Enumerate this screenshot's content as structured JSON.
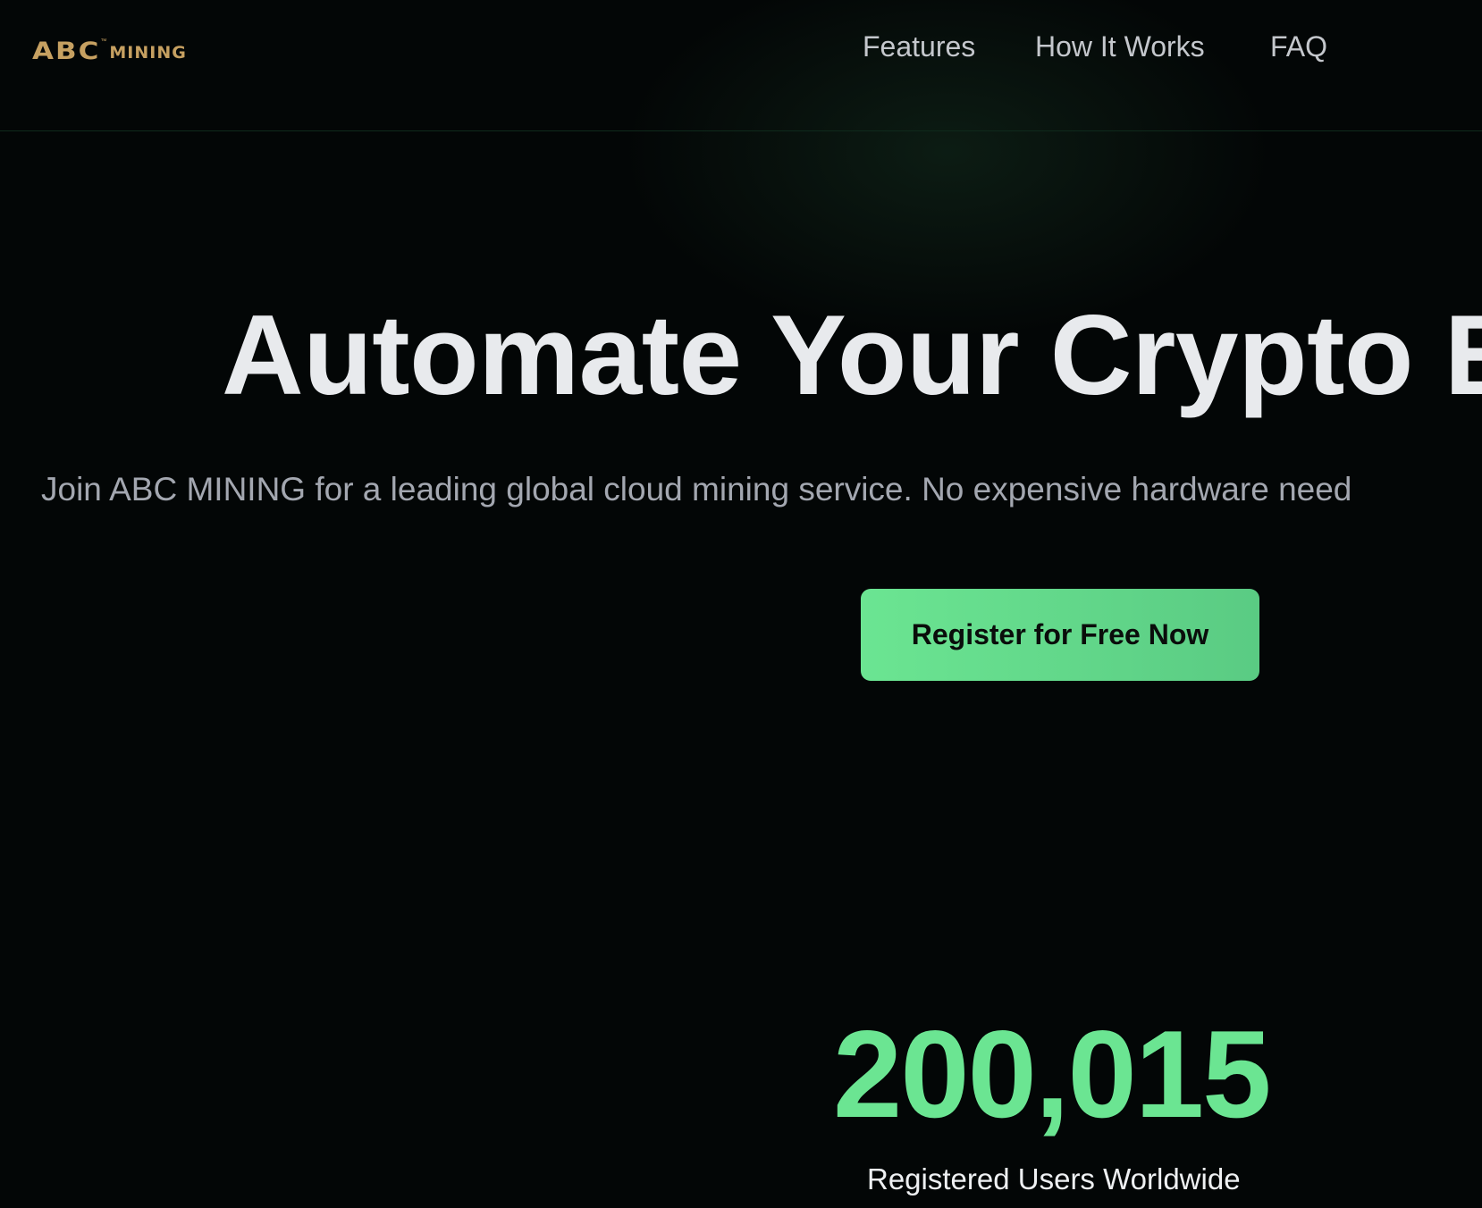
{
  "header": {
    "logo": {
      "brand": "ABC",
      "trademark": "™",
      "suffix": "MINING"
    },
    "nav": [
      {
        "label": "Features"
      },
      {
        "label": "How It Works"
      },
      {
        "label": "FAQ"
      }
    ]
  },
  "hero": {
    "title": "Automate Your Crypto E",
    "subtitle": "Join ABC MINING for a leading global cloud mining service. No expensive hardware need",
    "cta_label": "Register for Free Now"
  },
  "stats": {
    "value": "200,015",
    "label": "Registered Users Worldwide"
  },
  "colors": {
    "background": "#030606",
    "brand_gold": "#c6a061",
    "accent_green": "#6be592",
    "title_text": "#e8eaed",
    "subtitle_text": "#a3a7b0",
    "nav_text": "#c4c7cc"
  }
}
